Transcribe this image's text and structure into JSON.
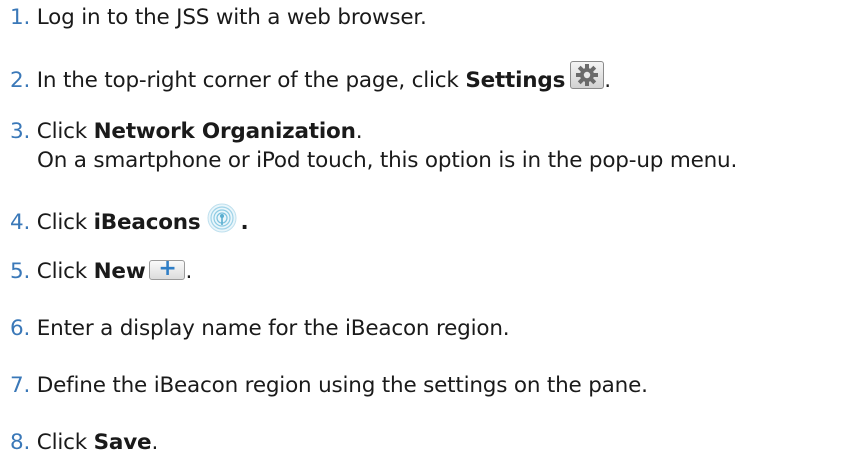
{
  "steps": [
    {
      "num": "1.",
      "text": "Log in to the JSS with a web browser."
    },
    {
      "num": "2.",
      "pre": "In the top-right corner of the page, click ",
      "bold": "Settings",
      "post": "."
    },
    {
      "num": "3.",
      "pre": "Click ",
      "bold": "Network Organization",
      "post": ".",
      "sub": "On a smartphone or iPod touch, this option is in the pop-up menu."
    },
    {
      "num": "4.",
      "pre": "Click ",
      "bold": "iBeacons",
      "post_bold": "."
    },
    {
      "num": "5.",
      "pre": "Click ",
      "bold": "New",
      "post": ".",
      "button_glyph": "+"
    },
    {
      "num": "6.",
      "text": "Enter a display name for the iBeacon region."
    },
    {
      "num": "7.",
      "text": "Define the iBeacon region using the settings on the pane."
    },
    {
      "num": "8.",
      "pre": "Click ",
      "bold": "Save",
      "post": "."
    }
  ],
  "icons": {
    "settings": "gear-icon",
    "ibeacons": "ibeacon-signal-icon",
    "new": "plus-icon"
  }
}
